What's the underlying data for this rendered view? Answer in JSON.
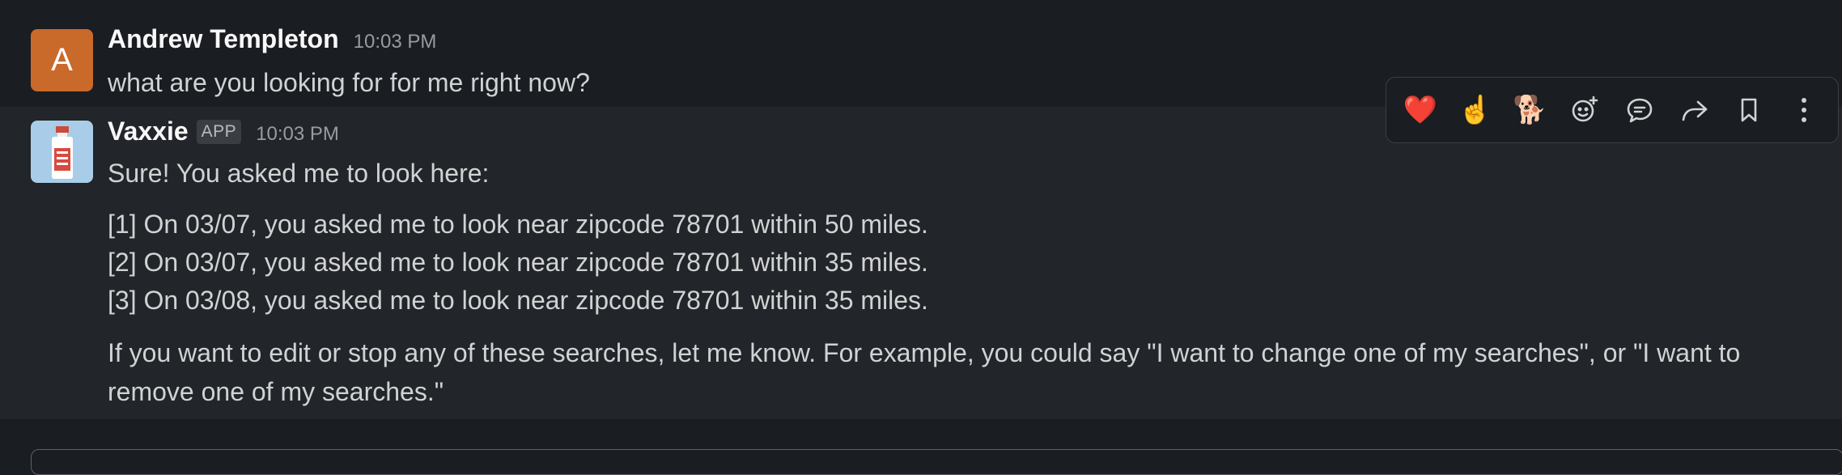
{
  "messages": [
    {
      "sender": "Andrew Templeton",
      "avatar_letter": "A",
      "avatar_color": "#c96a2a",
      "time": "10:03 PM",
      "text": "what are you looking for for me right now?"
    },
    {
      "sender": "Vaxxie",
      "badge": "APP",
      "time": "10:03 PM",
      "intro": "Sure! You asked me to look here:",
      "list": [
        "[1] On 03/07, you asked me to look near zipcode 78701 within 50 miles.",
        "[2] On 03/07, you asked me to look near zipcode 78701 within 35 miles.",
        "[3] On 03/08, you asked me to look near zipcode 78701 within 35 miles."
      ],
      "footer": "If you want to edit or stop any of these searches, let me know. For example, you could say \"I want to change one of my searches\", or \"I want to remove one of my searches.\""
    }
  ],
  "toolbar": {
    "reactions": [
      "❤️",
      "☝️",
      "🐕"
    ],
    "icons": [
      "add-reaction-icon",
      "reply-thread-icon",
      "share-icon",
      "bookmark-icon",
      "more-actions-icon"
    ]
  },
  "colors": {
    "background": "#1a1d21",
    "hover_row": "#222529",
    "accent_badge": "#3a3d42"
  }
}
